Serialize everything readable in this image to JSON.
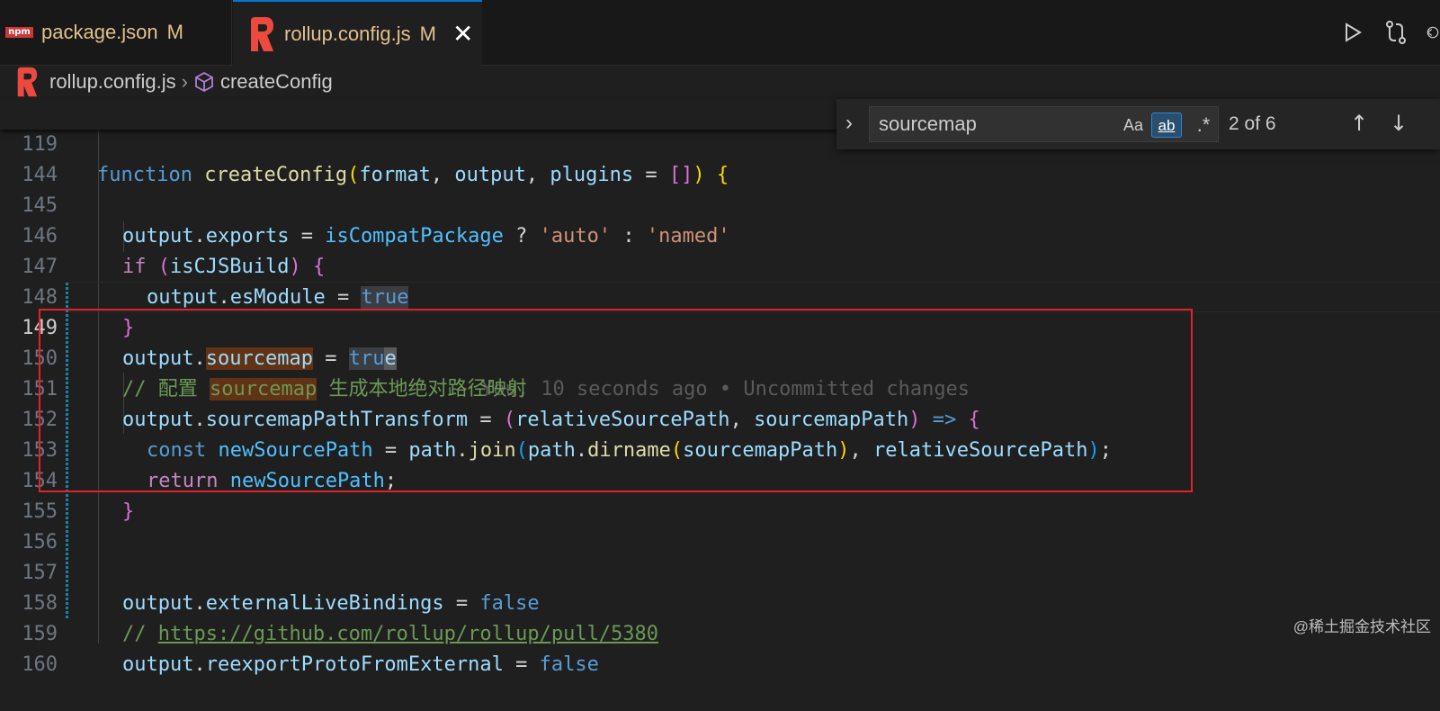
{
  "tabs": [
    {
      "label": "package.json",
      "status": "M",
      "icon": "npm-icon",
      "icon_text": "npm"
    },
    {
      "label": "rollup.config.js",
      "status": "M",
      "icon": "rollup-icon",
      "close": "✕"
    }
  ],
  "toolbar": {
    "icons": [
      "run-icon",
      "compare-changes-icon",
      "go-back-icon"
    ]
  },
  "breadcrumb": {
    "file": "rollup.config.js",
    "symbol": "createConfig"
  },
  "find": {
    "query": "sourcemap",
    "match_case": "Aa",
    "whole_word": "ab",
    "regex": ".*",
    "count": "2 of 6"
  },
  "lines": {
    "l119": {
      "num": "119",
      "kw": "function",
      "fn": "createConfig",
      "p1o": "(",
      "a1": "format",
      "c1": ", ",
      "a2": "output",
      "c2": ", ",
      "a3": "plugins",
      "eq": " = ",
      "br": "[]",
      "p1c": ")",
      "sp": " ",
      "brace": "{"
    },
    "l144": {
      "num": "144"
    },
    "l145": {
      "num": "145",
      "a": "output",
      "dot": ".",
      "b": "exports",
      "eq": " = ",
      "c": "isCompatPackage",
      "q": " ? ",
      "s1": "'auto'",
      "col": " : ",
      "s2": "'named'"
    },
    "l146": {
      "num": "146",
      "kw": "if",
      "sp": " ",
      "po": "(",
      "v": "isCJSBuild",
      "pc": ")",
      "sp2": " ",
      "br": "{"
    },
    "l147": {
      "num": "147",
      "a": "output",
      "dot": ".",
      "b": "esModule",
      "eq": " = ",
      "v": "true"
    },
    "l148": {
      "num": "148",
      "br": "}"
    },
    "l149": {
      "num": "149",
      "a": "output",
      "dot": ".",
      "b": "sourcemap",
      "eq": " = ",
      "v1": "tru",
      "v2": "e",
      "blame": "You, 10 seconds ago • Uncommitted changes"
    },
    "l150": {
      "num": "150",
      "c1": "// 配置 ",
      "c2": "sourcemap",
      "c3": " 生成本地绝对路径映射"
    },
    "l151": {
      "num": "151",
      "a": "output",
      "dot": ".",
      "b": "sourcemapPathTransform",
      "eq": " = ",
      "po": "(",
      "p1": "relativeSourcePath",
      "cm": ", ",
      "p2": "sourcemapPath",
      "pc": ")",
      "arrow": " => ",
      "br": "{"
    },
    "l152": {
      "num": "152",
      "kw": "const",
      "sp": " ",
      "v": "newSourcePath",
      "eq": " = ",
      "o1": "path",
      "d1": ".",
      "f1": "join",
      "po": "(",
      "o2": "path",
      "d2": ".",
      "f2": "dirname",
      "po2": "(",
      "a1": "sourcemapPath",
      "pc2": ")",
      "cm": ", ",
      "a2": "relativeSourcePath",
      "pc": ")",
      "semi": ";"
    },
    "l153": {
      "num": "153",
      "kw": "return",
      "sp": " ",
      "v": "newSourcePath",
      "semi": ";"
    },
    "l154": {
      "num": "154",
      "br": "}"
    },
    "l155": {
      "num": "155"
    },
    "l156": {
      "num": "156"
    },
    "l157": {
      "num": "157",
      "a": "output",
      "dot": ".",
      "b": "externalLiveBindings",
      "eq": " = ",
      "v": "false"
    },
    "l158": {
      "num": "158",
      "c": "// ",
      "link": "https://github.com/rollup/rollup/pull/5380"
    },
    "l159": {
      "num": "159",
      "a": "output",
      "dot": ".",
      "b": "reexportProtoFromExternal",
      "eq": " = ",
      "v": "false"
    },
    "l160": {
      "num": "160"
    }
  },
  "watermark": "@稀土掘金技术社区",
  "colors": {
    "accent": "#0078d4",
    "annotation_box": "#e0222c",
    "match_highlight": "#613214"
  }
}
